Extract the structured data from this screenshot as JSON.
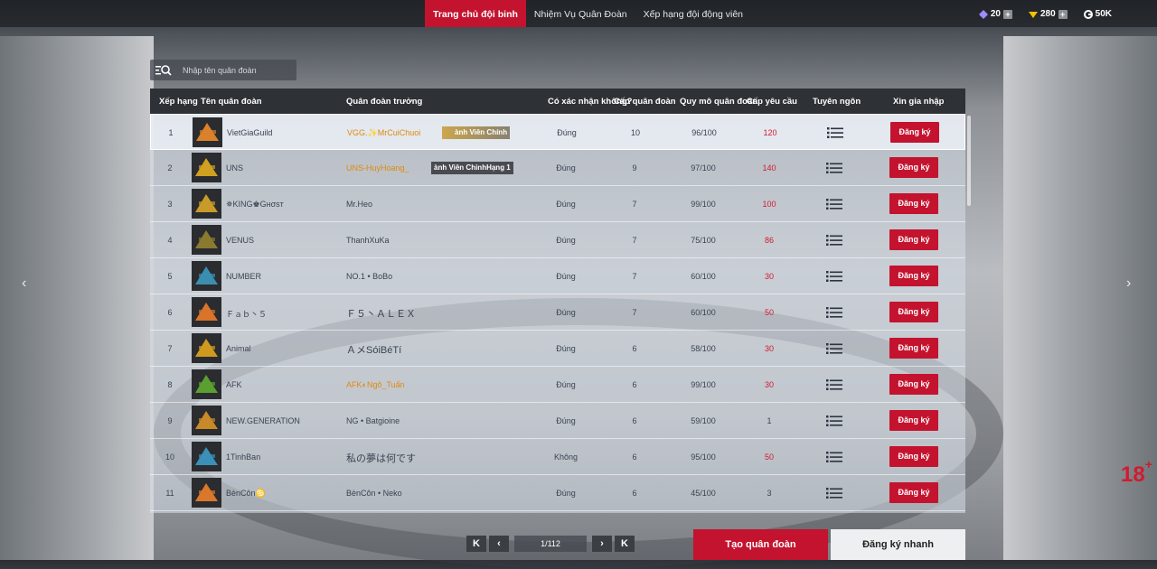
{
  "nav": {
    "tabs": [
      {
        "label": "Trang chủ đội binh"
      },
      {
        "label": "Nhiệm Vụ Quân Đoàn"
      },
      {
        "label": "Xếp hạng đội động viên"
      }
    ]
  },
  "currency": {
    "gems": "20",
    "coupons": "280",
    "gold": "50K"
  },
  "search": {
    "placeholder": "Nhập tên quân đoàn"
  },
  "table": {
    "headers": {
      "rank": "Xếp hạng",
      "name": "Tên quân đoàn",
      "leader": "Quân đoàn trưởng",
      "confirm": "Có xác nhận không?",
      "level": "Cấp quân đoàn",
      "size": "Quy mô quân đoàn",
      "requirement": "Cấp yêu cầu",
      "manifesto": "Tuyên ngôn",
      "join": "Xin gia nhập"
    },
    "join_label": "Đăng ký",
    "rows": [
      {
        "rank": "1",
        "name": "VietGiaGuild",
        "leader": "VGG.✨MrCuiChuoi",
        "badge": "ành Viên Chính",
        "confirm": "Đúng",
        "level": "10",
        "size": "96/100",
        "req": "120"
      },
      {
        "rank": "2",
        "name": "UNS",
        "leader": "UNS-HuyHoang_",
        "badge": "ành Viên ChinhHạng 1",
        "confirm": "Đúng",
        "level": "9",
        "size": "97/100",
        "req": "140"
      },
      {
        "rank": "3",
        "name": "✵KING♚Gнσѕт",
        "leader": "Mr.Heo",
        "confirm": "Đúng",
        "level": "7",
        "size": "99/100",
        "req": "100"
      },
      {
        "rank": "4",
        "name": "VENUS",
        "leader": "ThanhXuKa",
        "confirm": "Đúng",
        "level": "7",
        "size": "75/100",
        "req": "86"
      },
      {
        "rank": "5",
        "name": "NUMBER",
        "leader": "NO.1 • BoBo",
        "confirm": "Đúng",
        "level": "7",
        "size": "60/100",
        "req": "30"
      },
      {
        "rank": "6",
        "name": "Ｆａｂ丶５",
        "leader": "Ｆ５丶ＡＬＥＸ",
        "confirm": "Đúng",
        "level": "7",
        "size": "60/100",
        "req": "50"
      },
      {
        "rank": "7",
        "name": "Animal",
        "leader": "ＡメSóiBéTí",
        "confirm": "Đúng",
        "level": "6",
        "size": "58/100",
        "req": "30"
      },
      {
        "rank": "8",
        "name": "AFK",
        "leader": "AFK◐Ngô_Tuấn",
        "confirm": "Đúng",
        "level": "6",
        "size": "99/100",
        "req": "30"
      },
      {
        "rank": "9",
        "name": "NEW.GENERATION",
        "leader": "NG • Batgioine",
        "confirm": "Đúng",
        "level": "6",
        "size": "59/100",
        "req": "1"
      },
      {
        "rank": "10",
        "name": "1TinhBan",
        "leader": "私の夢は何です",
        "confirm": "Không",
        "level": "6",
        "size": "95/100",
        "req": "50"
      },
      {
        "rank": "11",
        "name": "BènCôn♋",
        "leader": "BènCôn • Neko",
        "confirm": "Đúng",
        "level": "6",
        "size": "45/100",
        "req": "3"
      }
    ]
  },
  "pagination": {
    "first": "K",
    "prev": "‹",
    "page": "1/112",
    "next": "›",
    "last": "K"
  },
  "actions": {
    "create": "Tạo quân đoàn",
    "quick_join": "Đăng ký nhanh"
  },
  "age_rating": "18",
  "colors": {
    "accent": "#c3132e",
    "requirement": "#d21a30",
    "leader_gold": "#e08a0c"
  }
}
